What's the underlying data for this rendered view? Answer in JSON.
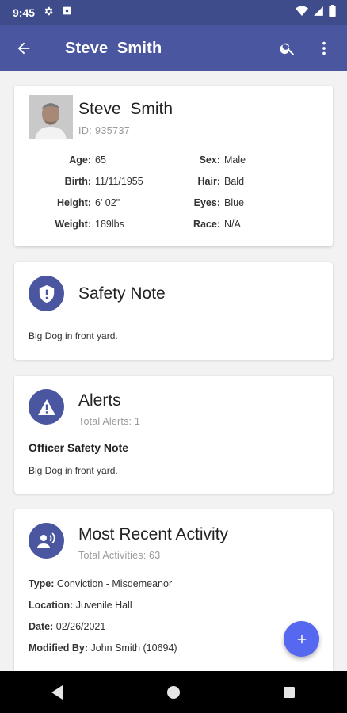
{
  "status_bar": {
    "time": "9:45",
    "icons": [
      "settings-icon",
      "storage-icon",
      "wifi-icon",
      "signal-icon",
      "battery-icon"
    ]
  },
  "app_bar": {
    "title": "Steve  Smith",
    "back_icon": "arrow-back-icon",
    "search_icon": "search-icon",
    "menu_icon": "more-vert-icon",
    "color": "#4a57a0"
  },
  "profile": {
    "name": "Steve  Smith",
    "id": "ID: 935737",
    "left_fields": [
      {
        "label": "Age:",
        "value": "65"
      },
      {
        "label": "Birth:",
        "value": "11/11/1955"
      },
      {
        "label": "Height:",
        "value": "6' 02\""
      },
      {
        "label": "Weight:",
        "value": "189lbs"
      }
    ],
    "right_fields": [
      {
        "label": "Sex:",
        "value": "Male"
      },
      {
        "label": "Hair:",
        "value": "Bald"
      },
      {
        "label": "Eyes:",
        "value": "Blue"
      },
      {
        "label": "Race:",
        "value": "N/A"
      }
    ]
  },
  "safety_note": {
    "title": "Safety Note",
    "icon": "shield-icon",
    "text": "Big Dog in front yard."
  },
  "alerts": {
    "title": "Alerts",
    "icon": "warning-icon",
    "total": "Total Alerts: 1",
    "item_title": "Officer Safety Note",
    "item_text": "Big Dog in front yard."
  },
  "activity": {
    "title": "Most Recent Activity",
    "icon": "speaker-icon",
    "total": "Total Activities: 63",
    "rows": [
      {
        "label": "Type:",
        "value": "Conviction - Misdemeanor"
      },
      {
        "label": "Location:",
        "value": "Juvenile Hall"
      },
      {
        "label": "Date:",
        "value": "02/26/2021"
      },
      {
        "label": "Modified By:",
        "value": "John Smith (10694)"
      }
    ]
  },
  "fab": {
    "icon": "plus-icon",
    "color": "#5668f0"
  },
  "nav_bar": {
    "icons": [
      "nav-back-icon",
      "nav-home-icon",
      "nav-recents-icon"
    ]
  }
}
